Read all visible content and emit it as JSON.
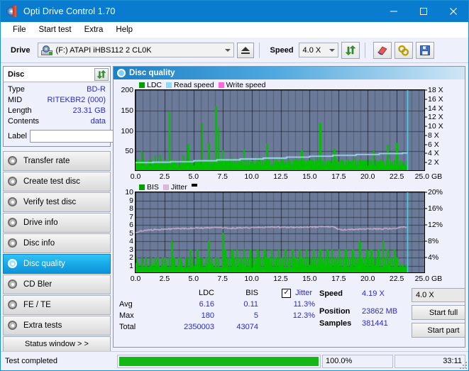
{
  "window": {
    "title": "Opti Drive Control 1.70",
    "icon": "disc-icon",
    "minimize": "minimize-icon",
    "maximize": "maximize-icon",
    "close": "close-icon"
  },
  "menu": {
    "items": [
      "File",
      "Start test",
      "Extra",
      "Help"
    ]
  },
  "toolbar": {
    "drive_label": "Drive",
    "drive_value": "(F:)  ATAPI iHBS112  2 CL0K",
    "eject": "eject-icon",
    "speed_label": "Speed",
    "speed_value": "4.0 X",
    "refresh": "refresh-icon",
    "eraser": "eraser-icon",
    "settings": "gear-icon",
    "save": "save-icon"
  },
  "disc": {
    "header": "Disc",
    "refresh": "refresh-icon",
    "rows": [
      {
        "key": "Type",
        "value": "BD-R"
      },
      {
        "key": "MID",
        "value": "RITEKBR2 (000)"
      },
      {
        "key": "Length",
        "value": "23.31 GB"
      },
      {
        "key": "Contents",
        "value": "data"
      }
    ],
    "label_key": "Label",
    "label_value": "",
    "label_placeholder": ""
  },
  "nav": {
    "items": [
      {
        "label": "Transfer rate",
        "active": false
      },
      {
        "label": "Create test disc",
        "active": false
      },
      {
        "label": "Verify test disc",
        "active": false
      },
      {
        "label": "Drive info",
        "active": false
      },
      {
        "label": "Disc info",
        "active": false
      },
      {
        "label": "Disc quality",
        "active": true
      },
      {
        "label": "CD Bler",
        "active": false
      },
      {
        "label": "FE / TE",
        "active": false
      },
      {
        "label": "Extra tests",
        "active": false
      }
    ],
    "status_window": "Status window > >"
  },
  "panel": {
    "title": "Disc quality"
  },
  "chart_data": [
    {
      "type": "line",
      "title": "Disc quality - LDC / Read speed",
      "xlabel": "GB",
      "ylabel": "",
      "y2label": "X",
      "xlim": [
        0,
        25
      ],
      "ylim": [
        0,
        200
      ],
      "y2lim": [
        0,
        18
      ],
      "grid": true,
      "legend": [
        {
          "name": "LDC",
          "color": "#00a000"
        },
        {
          "name": "Read speed",
          "color": "#8ed8f8"
        },
        {
          "name": "Write speed",
          "color": "#ff66e0"
        }
      ],
      "xticks": [
        "0.0",
        "2.5",
        "5.0",
        "7.5",
        "10.0",
        "12.5",
        "15.0",
        "17.5",
        "20.0",
        "22.5",
        "25.0"
      ],
      "yticks": [
        "200",
        "150",
        "100",
        "50"
      ],
      "y2ticks": [
        "18 X",
        "16 X",
        "14 X",
        "12 X",
        "10 X",
        "8 X",
        "6 X",
        "4 X",
        "2 X"
      ],
      "series": [
        {
          "name": "LDC",
          "color": "#00c000",
          "kind": "area-spikes",
          "baseline": 22,
          "x": [
            0.1,
            0.3,
            0.5,
            0.7,
            0.9,
            1.1,
            1.3,
            1.5,
            1.7,
            1.9,
            2.1,
            2.3,
            2.5,
            2.7,
            2.9,
            3.1,
            3.3,
            3.5,
            3.7,
            3.9,
            4.1,
            4.3,
            4.5,
            4.7,
            4.9,
            5.1,
            5.3,
            5.5,
            5.7,
            5.9,
            6.1,
            6.3,
            6.5,
            6.7,
            6.9,
            7.1,
            7.3,
            7.5,
            7.7,
            7.9,
            8.1,
            8.3,
            8.5,
            8.7,
            8.9,
            9.1,
            9.3,
            9.5,
            9.7,
            9.9,
            10.1,
            10.3,
            10.5,
            10.7,
            10.9,
            11.1,
            11.3,
            11.5,
            11.7,
            11.9,
            12.1,
            12.3,
            12.5,
            12.7,
            12.9,
            13.1,
            13.3,
            13.5,
            13.7,
            13.9,
            14.1,
            14.3,
            14.5,
            14.7,
            14.9,
            15.1,
            15.3,
            15.5,
            15.7,
            15.9,
            16.1,
            16.3,
            16.5,
            16.7,
            16.9,
            17.1,
            17.3,
            17.5,
            17.7,
            17.9,
            18.1,
            18.3,
            18.5,
            18.7,
            18.9,
            19.1,
            19.3,
            19.5,
            19.7,
            19.9,
            20.1,
            20.3,
            20.5,
            20.7,
            20.9,
            21.1,
            21.3,
            21.5,
            21.7,
            21.9,
            22.1,
            22.3,
            22.5,
            22.7,
            22.9,
            23.1,
            23.3
          ],
          "values": [
            30,
            22,
            50,
            28,
            22,
            25,
            30,
            22,
            40,
            26,
            42,
            24,
            28,
            24,
            148,
            30,
            24,
            28,
            22,
            26,
            40,
            22,
            68,
            24,
            28,
            22,
            30,
            24,
            120,
            28,
            24,
            70,
            26,
            30,
            160,
            108,
            24,
            52,
            30,
            28,
            24,
            36,
            28,
            24,
            30,
            22,
            56,
            26,
            30,
            24,
            28,
            22,
            34,
            26,
            30,
            24,
            68,
            28,
            22,
            26,
            30,
            24,
            32,
            28,
            24,
            30,
            26,
            22,
            28,
            30,
            24,
            52,
            28,
            22,
            26,
            30,
            24,
            34,
            28,
            120,
            26,
            30,
            24,
            28,
            22,
            56,
            30,
            24,
            28,
            26,
            22,
            30,
            24,
            28,
            34,
            24,
            30,
            26,
            22,
            28,
            30,
            24,
            52,
            28,
            24,
            30,
            26,
            22,
            66,
            30,
            24,
            28,
            70
          ]
        },
        {
          "name": "Read speed",
          "color": "#a7e2fb",
          "kind": "step-line",
          "x": [
            0.0,
            1.5,
            3.0,
            5.0,
            7.0,
            9.0,
            11.0,
            13.0,
            15.0,
            17.0,
            19.0,
            21.0,
            23.0,
            23.4
          ],
          "values_x": [
            2.0,
            2.1,
            2.2,
            2.4,
            2.6,
            2.8,
            3.0,
            3.2,
            3.4,
            3.6,
            3.8,
            4.0,
            4.1,
            4.19
          ]
        }
      ],
      "markers": {
        "cursor_x": 23.4
      }
    },
    {
      "type": "line",
      "title": "Disc quality - BIS / Jitter",
      "xlabel": "GB",
      "ylabel": "",
      "y2label": "%",
      "xlim": [
        0,
        25
      ],
      "ylim": [
        0,
        10
      ],
      "y2lim": [
        0,
        20
      ],
      "grid": true,
      "legend": [
        {
          "name": "BIS",
          "color": "#00a000"
        },
        {
          "name": "Jitter",
          "color": "#dbb6da"
        }
      ],
      "xticks": [
        "0.0",
        "2.5",
        "5.0",
        "7.5",
        "10.0",
        "12.5",
        "15.0",
        "17.5",
        "20.0",
        "22.5",
        "25.0"
      ],
      "yticks": [
        "10",
        "9",
        "8",
        "7",
        "6",
        "5",
        "4",
        "3",
        "2",
        "1"
      ],
      "y2ticks": [
        "20%",
        "16%",
        "12%",
        "8%",
        "4%"
      ],
      "series": [
        {
          "name": "BIS",
          "color": "#00c000",
          "kind": "area-spikes",
          "baseline": 1.0,
          "x": [
            0.1,
            0.3,
            0.5,
            0.7,
            0.9,
            1.1,
            1.3,
            1.5,
            1.7,
            1.9,
            2.1,
            2.3,
            2.5,
            2.7,
            2.9,
            3.1,
            3.3,
            3.5,
            3.7,
            3.9,
            4.1,
            4.3,
            4.5,
            4.7,
            4.9,
            5.1,
            5.3,
            5.5,
            5.7,
            5.9,
            6.1,
            6.3,
            6.5,
            6.7,
            6.9,
            7.1,
            7.3,
            7.5,
            7.7,
            7.9,
            8.1,
            8.3,
            8.5,
            8.7,
            8.9,
            9.1,
            9.3,
            9.5,
            9.7,
            9.9,
            10.1,
            10.3,
            10.5,
            10.7,
            10.9,
            11.1,
            11.3,
            11.5,
            11.7,
            11.9,
            12.1,
            12.3,
            12.5,
            12.7,
            12.9,
            13.1,
            13.3,
            13.5,
            13.7,
            13.9,
            14.1,
            14.3,
            14.5,
            14.7,
            14.9,
            15.1,
            15.3,
            15.5,
            15.7,
            15.9,
            16.1,
            16.3,
            16.5,
            16.7,
            16.9,
            17.1,
            17.3,
            17.5,
            17.7,
            17.9,
            18.1,
            18.3,
            18.5,
            18.7,
            18.9,
            19.1,
            19.3,
            19.5,
            19.7,
            19.9,
            20.1,
            20.3,
            20.5,
            20.7,
            20.9,
            21.1,
            21.3,
            21.5,
            21.7,
            21.9,
            22.1,
            22.3,
            22.5,
            22.7,
            22.9,
            23.1,
            23.3
          ],
          "values": [
            2,
            1,
            2,
            1,
            2,
            1,
            2,
            1,
            2,
            2,
            1,
            2,
            2,
            1,
            2,
            4,
            2,
            1,
            2,
            2,
            1,
            2,
            2,
            3,
            2,
            1,
            3,
            2,
            2,
            1,
            2,
            4,
            2,
            1,
            2,
            2,
            1,
            5,
            3,
            2,
            2,
            3,
            2,
            3,
            2,
            2,
            3,
            2,
            2,
            3,
            2,
            2,
            3,
            2,
            2,
            3,
            2,
            2,
            3,
            2,
            2,
            3,
            2,
            2,
            3,
            2,
            2,
            3,
            2,
            2,
            3,
            2,
            2,
            3,
            2,
            2,
            3,
            2,
            2,
            3,
            2,
            2,
            3,
            2,
            3,
            2,
            2,
            3,
            2,
            2,
            3,
            2,
            2,
            3,
            2,
            2,
            4,
            2,
            2,
            3,
            2,
            3,
            2,
            2,
            3,
            2,
            4,
            2,
            3,
            2,
            2,
            3,
            2
          ]
        },
        {
          "name": "Jitter",
          "color": "#dbb6da",
          "kind": "line",
          "x": [
            0.0,
            0.4,
            1.0,
            2.0,
            3.0,
            4.0,
            5.0,
            6.0,
            7.0,
            8.0,
            9.0,
            10.0,
            11.0,
            12.0,
            13.0,
            14.0,
            15.0,
            16.0,
            17.0,
            17.6,
            18.0,
            19.0,
            20.0,
            21.0,
            22.0,
            23.0,
            23.4
          ],
          "values": [
            5.0,
            5.2,
            5.35,
            5.45,
            5.5,
            5.55,
            5.6,
            5.62,
            5.68,
            5.6,
            5.62,
            5.65,
            5.7,
            5.72,
            5.7,
            5.7,
            5.72,
            5.75,
            5.78,
            5.4,
            5.4,
            5.45,
            5.5,
            5.5,
            5.55,
            5.7,
            5.75
          ]
        }
      ],
      "markers": {
        "cursor_x": 23.4
      }
    }
  ],
  "stats": {
    "columns": [
      "",
      "LDC",
      "BIS",
      "Jitter"
    ],
    "jitter_checked": true,
    "jitter_check_glyph": "✓",
    "rows": [
      {
        "label": "Avg",
        "ldc": "6.16",
        "bis": "0.11",
        "jitter": "11.3%"
      },
      {
        "label": "Max",
        "ldc": "180",
        "bis": "5",
        "jitter": "12.3%"
      },
      {
        "label": "Total",
        "ldc": "2350003",
        "bis": "43074",
        "jitter": ""
      }
    ]
  },
  "results": {
    "speed_key": "Speed",
    "speed_value": "4.19 X",
    "position_key": "Position",
    "position_value": "23862 MB",
    "samples_key": "Samples",
    "samples_value": "381441",
    "speed_select": "4.0 X",
    "start_full": "Start full",
    "start_part": "Start part"
  },
  "statusbar": {
    "message": "Test completed",
    "progress_percent": "100.0%",
    "progress_value": 100,
    "elapsed": "33:11"
  },
  "colors": {
    "accent": "#0a7cd0",
    "plot_bg": "#6b7a99",
    "ldc_green": "#00c000",
    "read_speed": "#a7e2fb",
    "write_speed": "#ff66e0",
    "jitter": "#dbb6da",
    "value_blue": "#2b2bc8",
    "progress_green": "#14b814"
  }
}
